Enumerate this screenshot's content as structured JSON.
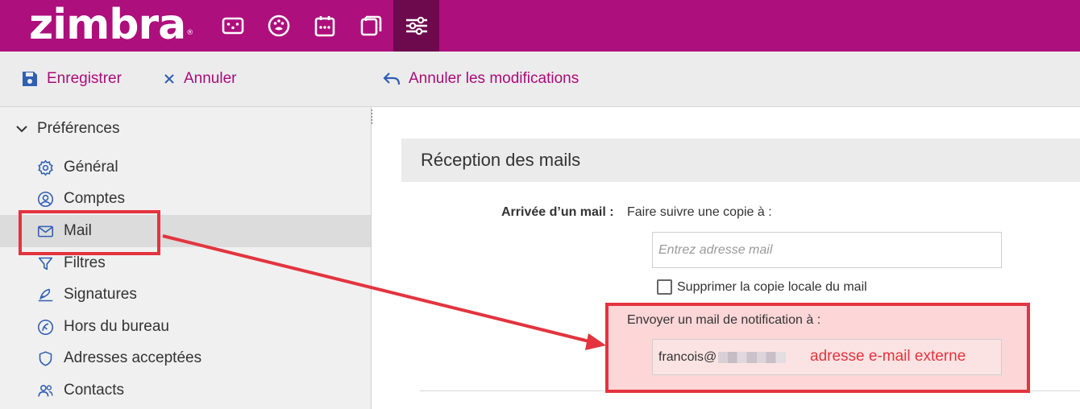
{
  "app": {
    "logo": "zimbra",
    "logo_mark": "®"
  },
  "topnav": {
    "icons": [
      "mail-app-icon",
      "contacts-app-icon",
      "calendar-app-icon",
      "tasks-app-icon",
      "preferences-app-icon"
    ],
    "active": "preferences-app-icon"
  },
  "toolbar": {
    "save_label": "Enregistrer",
    "cancel_label": "Annuler",
    "undo_label": "Annuler les modifications"
  },
  "sidebar": {
    "header": "Préférences",
    "items": [
      {
        "label": "Général",
        "icon": "gear-icon"
      },
      {
        "label": "Comptes",
        "icon": "account-icon"
      },
      {
        "label": "Mail",
        "icon": "mail-icon",
        "selected": true
      },
      {
        "label": "Filtres",
        "icon": "filter-icon"
      },
      {
        "label": "Signatures",
        "icon": "signature-icon"
      },
      {
        "label": "Hors du bureau",
        "icon": "out-of-office-icon"
      },
      {
        "label": "Adresses acceptées",
        "icon": "shield-icon"
      },
      {
        "label": "Contacts",
        "icon": "contacts-icon"
      }
    ]
  },
  "main": {
    "section_title": "Réception des mails",
    "arrival_label": "Arrivée d’un mail :",
    "forward_label": "Faire suivre une copie à :",
    "forward_placeholder": "Entrez adresse mail",
    "delete_local_label": "Supprimer la copie locale du mail",
    "delete_local_checked": false,
    "notify_label": "Envoyer un mail de notification à :",
    "notify_value": "francois@"
  },
  "annotations": {
    "note": "adresse e-mail externe",
    "color": "#e3343f"
  },
  "colors": {
    "brand": "#ad0f7c",
    "accent_text": "#a80d79",
    "active_app": "#6d0a4e",
    "annotation_fill": "#fdd6d7"
  }
}
